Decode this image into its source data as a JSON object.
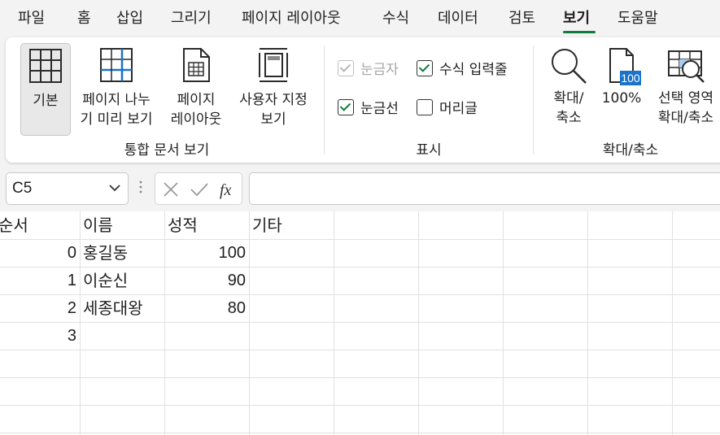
{
  "menu": {
    "tabs": [
      {
        "label": "파일",
        "active": false
      },
      {
        "label": "홈",
        "active": false
      },
      {
        "label": "삽입",
        "active": false
      },
      {
        "label": "그리기",
        "active": false
      },
      {
        "label": "페이지 레이아웃",
        "active": false
      },
      {
        "label": "수식",
        "active": false
      },
      {
        "label": "데이터",
        "active": false
      },
      {
        "label": "검토",
        "active": false
      },
      {
        "label": "보기",
        "active": true
      },
      {
        "label": "도움말",
        "active": false
      }
    ]
  },
  "ribbon": {
    "workbook_views": {
      "label": "통합 문서 보기",
      "normal": "기본",
      "page_break_line1": "페이지 나누",
      "page_break_line2": "기 미리 보기",
      "page_layout_line1": "페이지",
      "page_layout_line2": "레이아웃",
      "custom_line1": "사용자 지정",
      "custom_line2": "보기"
    },
    "show": {
      "label": "표시",
      "ruler": {
        "label": "눈금자",
        "checked": true,
        "disabled": true
      },
      "formula_bar": {
        "label": "수식 입력줄",
        "checked": true,
        "disabled": false
      },
      "gridlines": {
        "label": "눈금선",
        "checked": true,
        "disabled": false
      },
      "headings": {
        "label": "머리글",
        "checked": false,
        "disabled": false
      }
    },
    "zoom": {
      "label": "확대/축소",
      "zoom_line1": "확대/",
      "zoom_line2": "축소",
      "zoom100": "100%",
      "zoom100_icon_text": "100",
      "selection_line1": "선택 영역",
      "selection_line2": "확대/축소"
    }
  },
  "formula_bar": {
    "name_box": "C5",
    "formula": ""
  },
  "sheet": {
    "headers": [
      "순서",
      "이름",
      "성적",
      "기타"
    ],
    "rows": [
      {
        "order": "0",
        "name": "홍길동",
        "score": "100"
      },
      {
        "order": "1",
        "name": "이순신",
        "score": "90"
      },
      {
        "order": "2",
        "name": "세종대왕",
        "score": "80"
      },
      {
        "order": "3",
        "name": "",
        "score": ""
      }
    ]
  },
  "colors": {
    "accent": "#107c41",
    "zoom_blue": "#1a73c8",
    "gridline": "#e1e1e1"
  },
  "icons": [
    "normal-view-icon",
    "page-break-view-icon",
    "page-layout-icon",
    "custom-views-icon",
    "zoom-icon",
    "zoom-100-icon",
    "zoom-to-selection-icon",
    "cancel-icon",
    "enter-icon",
    "function-icon",
    "chevron-down-icon"
  ]
}
